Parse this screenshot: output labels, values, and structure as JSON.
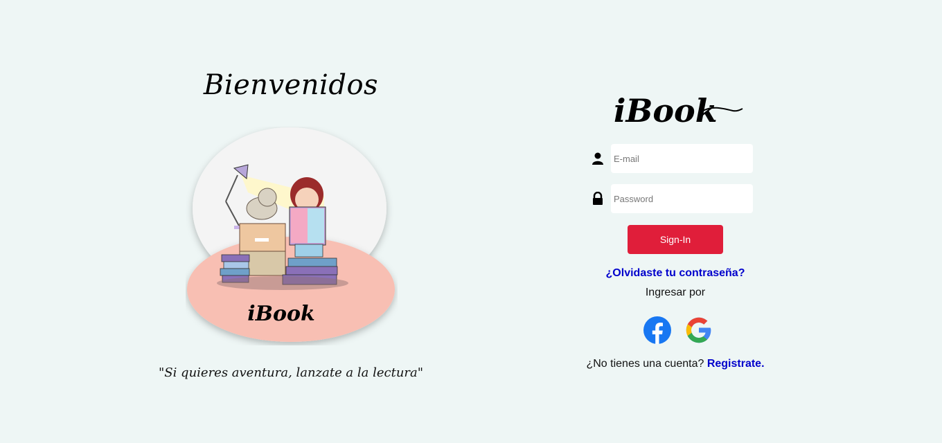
{
  "welcome": {
    "title": "Bienvenidos",
    "quote": "\"Si quieres aventura, lanzate a la lectura\"",
    "illustration_logo": "iBook"
  },
  "login": {
    "logo": "iBook",
    "email_placeholder": "E-mail",
    "password_placeholder": "Password",
    "signin_label": "Sign-In",
    "forgot_label": "¿Olvidaste tu contraseña?",
    "ingresar_label": "Ingresar por",
    "social": [
      {
        "name": "facebook",
        "icon": "facebook-icon",
        "color": "#1877f2"
      },
      {
        "name": "google",
        "icon": "google-icon"
      }
    ],
    "no_account_text": "¿No tienes una cuenta?",
    "register_label": "Registrate."
  },
  "colors": {
    "background": "#eef6f5",
    "accent": "#e01e3a",
    "link": "#0000cc"
  }
}
